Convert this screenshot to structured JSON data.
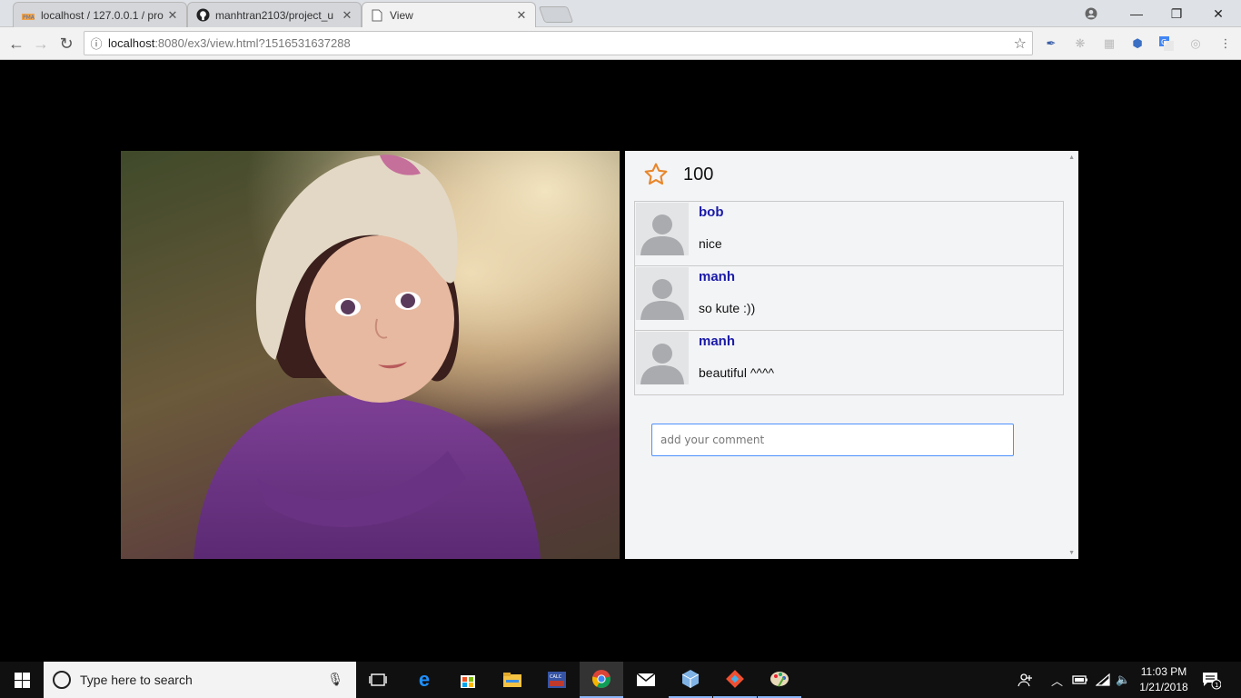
{
  "browser": {
    "tabs": [
      {
        "title": "localhost / 127.0.0.1 / pro",
        "favicon": "phpmyadmin-icon",
        "active": false
      },
      {
        "title": "manhtran2103/project_u",
        "favicon": "github-icon",
        "active": false
      },
      {
        "title": "View",
        "favicon": "page-icon",
        "active": true
      }
    ],
    "url": {
      "host": "localhost",
      "path": ":8080/ex3/view.html?1516531637288"
    }
  },
  "panel": {
    "likes": "100",
    "comments": [
      {
        "author": "bob",
        "text": "nice"
      },
      {
        "author": "manh",
        "text": "so kute :))"
      },
      {
        "author": "manh",
        "text": "beautiful ^^^^"
      }
    ],
    "input_placeholder": "add your comment"
  },
  "taskbar": {
    "search_placeholder": "Type here to search",
    "time": "11:03 PM",
    "date": "1/21/2018",
    "notification_count": "1"
  },
  "colors": {
    "author": "#1a1aa8",
    "star": "#e8862a",
    "input_focus": "#4d90fe"
  }
}
